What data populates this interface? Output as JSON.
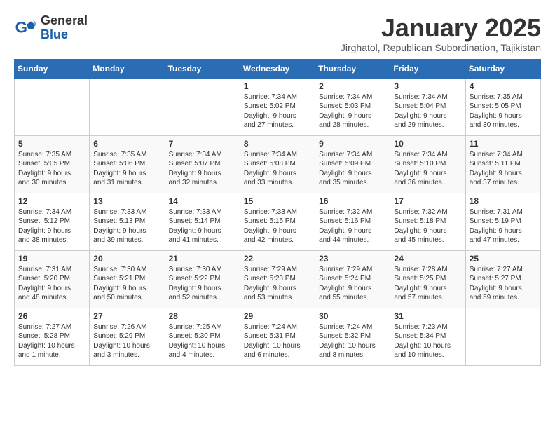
{
  "header": {
    "logo_general": "General",
    "logo_blue": "Blue",
    "month": "January 2025",
    "location": "Jirghatol, Republican Subordination, Tajikistan"
  },
  "weekdays": [
    "Sunday",
    "Monday",
    "Tuesday",
    "Wednesday",
    "Thursday",
    "Friday",
    "Saturday"
  ],
  "weeks": [
    [
      {
        "day": "",
        "info": ""
      },
      {
        "day": "",
        "info": ""
      },
      {
        "day": "",
        "info": ""
      },
      {
        "day": "1",
        "info": "Sunrise: 7:34 AM\nSunset: 5:02 PM\nDaylight: 9 hours\nand 27 minutes."
      },
      {
        "day": "2",
        "info": "Sunrise: 7:34 AM\nSunset: 5:03 PM\nDaylight: 9 hours\nand 28 minutes."
      },
      {
        "day": "3",
        "info": "Sunrise: 7:34 AM\nSunset: 5:04 PM\nDaylight: 9 hours\nand 29 minutes."
      },
      {
        "day": "4",
        "info": "Sunrise: 7:35 AM\nSunset: 5:05 PM\nDaylight: 9 hours\nand 30 minutes."
      }
    ],
    [
      {
        "day": "5",
        "info": "Sunrise: 7:35 AM\nSunset: 5:05 PM\nDaylight: 9 hours\nand 30 minutes."
      },
      {
        "day": "6",
        "info": "Sunrise: 7:35 AM\nSunset: 5:06 PM\nDaylight: 9 hours\nand 31 minutes."
      },
      {
        "day": "7",
        "info": "Sunrise: 7:34 AM\nSunset: 5:07 PM\nDaylight: 9 hours\nand 32 minutes."
      },
      {
        "day": "8",
        "info": "Sunrise: 7:34 AM\nSunset: 5:08 PM\nDaylight: 9 hours\nand 33 minutes."
      },
      {
        "day": "9",
        "info": "Sunrise: 7:34 AM\nSunset: 5:09 PM\nDaylight: 9 hours\nand 35 minutes."
      },
      {
        "day": "10",
        "info": "Sunrise: 7:34 AM\nSunset: 5:10 PM\nDaylight: 9 hours\nand 36 minutes."
      },
      {
        "day": "11",
        "info": "Sunrise: 7:34 AM\nSunset: 5:11 PM\nDaylight: 9 hours\nand 37 minutes."
      }
    ],
    [
      {
        "day": "12",
        "info": "Sunrise: 7:34 AM\nSunset: 5:12 PM\nDaylight: 9 hours\nand 38 minutes."
      },
      {
        "day": "13",
        "info": "Sunrise: 7:33 AM\nSunset: 5:13 PM\nDaylight: 9 hours\nand 39 minutes."
      },
      {
        "day": "14",
        "info": "Sunrise: 7:33 AM\nSunset: 5:14 PM\nDaylight: 9 hours\nand 41 minutes."
      },
      {
        "day": "15",
        "info": "Sunrise: 7:33 AM\nSunset: 5:15 PM\nDaylight: 9 hours\nand 42 minutes."
      },
      {
        "day": "16",
        "info": "Sunrise: 7:32 AM\nSunset: 5:16 PM\nDaylight: 9 hours\nand 44 minutes."
      },
      {
        "day": "17",
        "info": "Sunrise: 7:32 AM\nSunset: 5:18 PM\nDaylight: 9 hours\nand 45 minutes."
      },
      {
        "day": "18",
        "info": "Sunrise: 7:31 AM\nSunset: 5:19 PM\nDaylight: 9 hours\nand 47 minutes."
      }
    ],
    [
      {
        "day": "19",
        "info": "Sunrise: 7:31 AM\nSunset: 5:20 PM\nDaylight: 9 hours\nand 48 minutes."
      },
      {
        "day": "20",
        "info": "Sunrise: 7:30 AM\nSunset: 5:21 PM\nDaylight: 9 hours\nand 50 minutes."
      },
      {
        "day": "21",
        "info": "Sunrise: 7:30 AM\nSunset: 5:22 PM\nDaylight: 9 hours\nand 52 minutes."
      },
      {
        "day": "22",
        "info": "Sunrise: 7:29 AM\nSunset: 5:23 PM\nDaylight: 9 hours\nand 53 minutes."
      },
      {
        "day": "23",
        "info": "Sunrise: 7:29 AM\nSunset: 5:24 PM\nDaylight: 9 hours\nand 55 minutes."
      },
      {
        "day": "24",
        "info": "Sunrise: 7:28 AM\nSunset: 5:25 PM\nDaylight: 9 hours\nand 57 minutes."
      },
      {
        "day": "25",
        "info": "Sunrise: 7:27 AM\nSunset: 5:27 PM\nDaylight: 9 hours\nand 59 minutes."
      }
    ],
    [
      {
        "day": "26",
        "info": "Sunrise: 7:27 AM\nSunset: 5:28 PM\nDaylight: 10 hours\nand 1 minute."
      },
      {
        "day": "27",
        "info": "Sunrise: 7:26 AM\nSunset: 5:29 PM\nDaylight: 10 hours\nand 3 minutes."
      },
      {
        "day": "28",
        "info": "Sunrise: 7:25 AM\nSunset: 5:30 PM\nDaylight: 10 hours\nand 4 minutes."
      },
      {
        "day": "29",
        "info": "Sunrise: 7:24 AM\nSunset: 5:31 PM\nDaylight: 10 hours\nand 6 minutes."
      },
      {
        "day": "30",
        "info": "Sunrise: 7:24 AM\nSunset: 5:32 PM\nDaylight: 10 hours\nand 8 minutes."
      },
      {
        "day": "31",
        "info": "Sunrise: 7:23 AM\nSunset: 5:34 PM\nDaylight: 10 hours\nand 10 minutes."
      },
      {
        "day": "",
        "info": ""
      }
    ]
  ]
}
